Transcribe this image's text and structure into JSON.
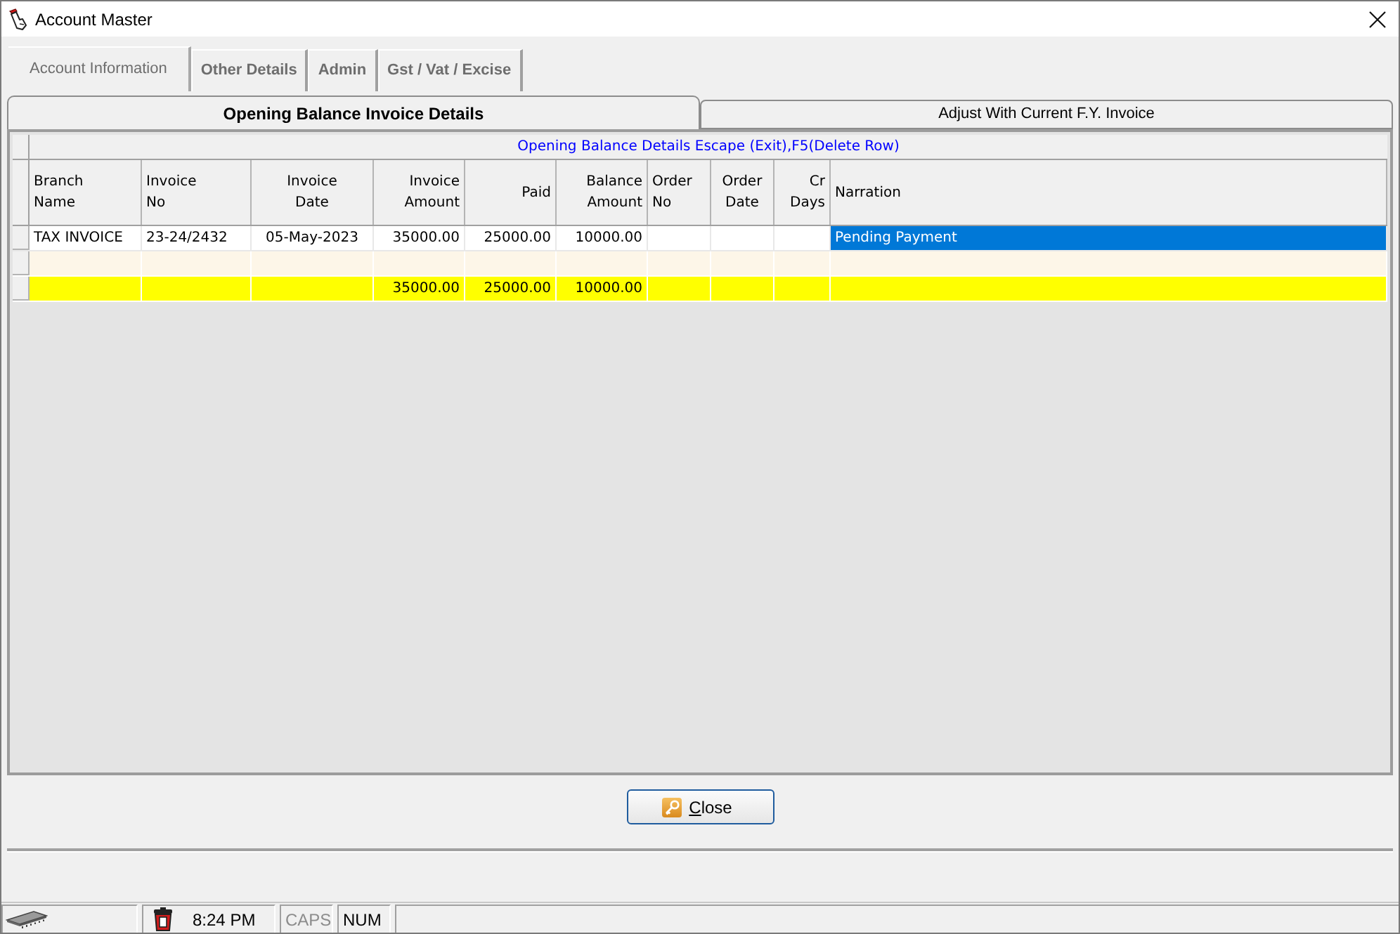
{
  "window": {
    "title": "Account Master"
  },
  "tabs": [
    {
      "label": "Account Information",
      "selected": true
    },
    {
      "label": "Other Details",
      "selected": false
    },
    {
      "label": "Admin",
      "selected": false
    },
    {
      "label": "Gst / Vat / Excise",
      "selected": false
    }
  ],
  "subtabs": [
    {
      "label": "Opening Balance Invoice Details",
      "selected": true
    },
    {
      "label": "Adjust With Current F.Y. Invoice",
      "selected": false
    }
  ],
  "grid": {
    "caption": "Opening Balance Details Escape (Exit),F5(Delete Row)",
    "columns": [
      {
        "label": "Branch Name",
        "kind": "text"
      },
      {
        "label": "Invoice No",
        "kind": "text"
      },
      {
        "label": "Invoice Date",
        "kind": "date"
      },
      {
        "label": "Invoice Amount",
        "kind": "amount"
      },
      {
        "label": "Paid",
        "kind": "amount"
      },
      {
        "label": "Balance Amount",
        "kind": "amount"
      },
      {
        "label": "Order No",
        "kind": "text"
      },
      {
        "label": "Order Date",
        "kind": "date"
      },
      {
        "label": "Cr Days",
        "kind": "number"
      },
      {
        "label": "Narration",
        "kind": "text"
      }
    ],
    "rows": [
      {
        "kind": "entry",
        "cells": [
          {
            "text": "TAX INVOICE",
            "selected": false
          },
          {
            "text": "23-24/2432",
            "selected": false
          },
          {
            "text": "05-May-2023",
            "selected": false
          },
          {
            "text": "35000.00",
            "selected": false
          },
          {
            "text": "25000.00",
            "selected": false
          },
          {
            "text": "10000.00",
            "selected": false
          },
          {
            "selected": false
          },
          {
            "selected": false
          },
          {
            "selected": false
          },
          {
            "text": "Pending Payment",
            "selected": true
          }
        ]
      },
      {
        "kind": "new",
        "cells": [
          {
            "selected": false
          },
          {
            "selected": false
          },
          {
            "selected": false
          },
          {
            "selected": false
          },
          {
            "selected": false
          },
          {
            "selected": false
          },
          {
            "selected": false
          },
          {
            "selected": false
          },
          {
            "selected": false
          },
          {
            "selected": false
          }
        ]
      },
      {
        "kind": "total",
        "cells": [
          {
            "selected": false
          },
          {
            "selected": false
          },
          {
            "selected": false
          },
          {
            "text": "35000.00",
            "selected": false
          },
          {
            "text": "25000.00",
            "selected": false
          },
          {
            "text": "10000.00",
            "selected": false
          },
          {
            "selected": false
          },
          {
            "selected": false
          },
          {
            "selected": false
          },
          {
            "selected": false
          }
        ]
      }
    ]
  },
  "close_button": {
    "label": "Close"
  },
  "status_bar": {
    "time": "8:24 PM",
    "indicators": [
      {
        "label": "CAPS",
        "on": false
      },
      {
        "label": "NUM",
        "on": true
      }
    ]
  }
}
